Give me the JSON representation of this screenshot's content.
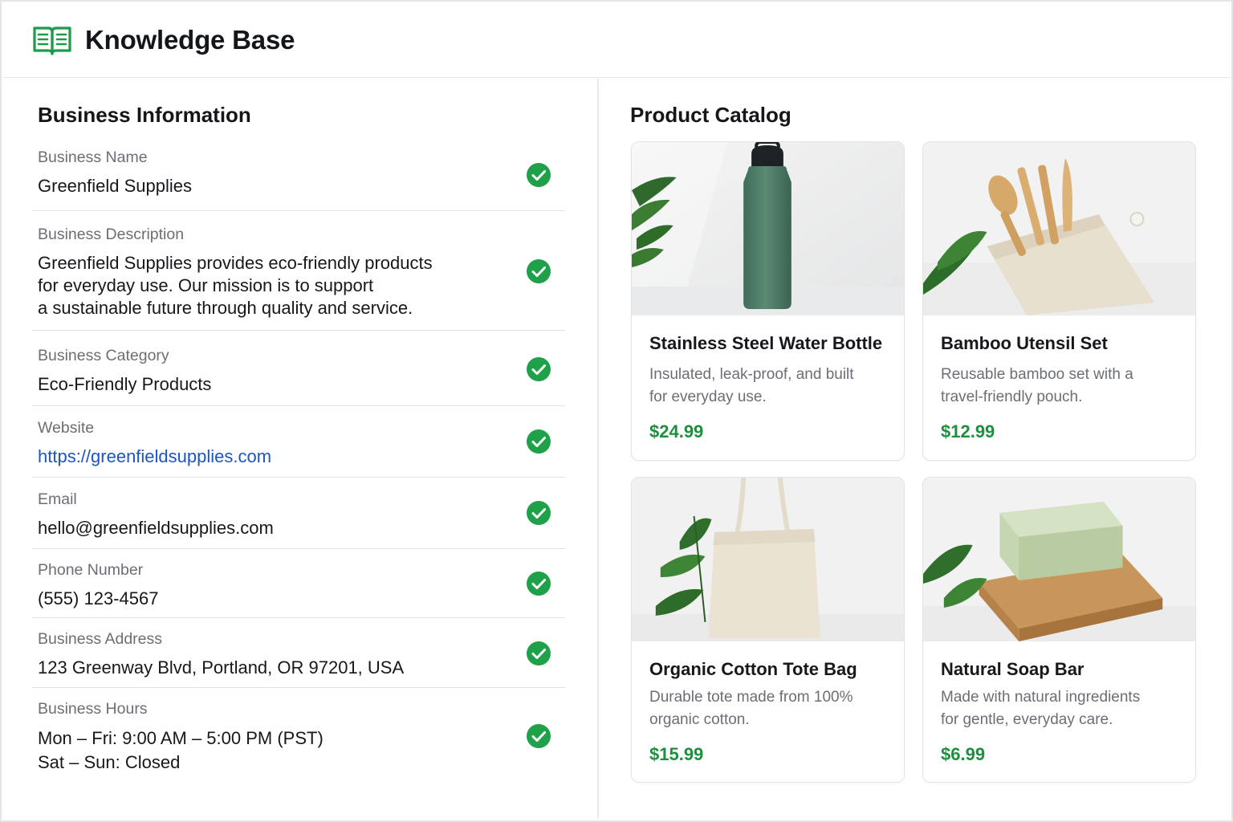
{
  "header": {
    "title": "Knowledge Base",
    "icon": "book-icon",
    "icon_color": "#1e9a4b"
  },
  "business": {
    "title": "Business Information",
    "rows": [
      {
        "label": "Business Name",
        "value": "Greenfield Supplies",
        "verified": true
      },
      {
        "label": "Business Description",
        "value": "Greenfield Supplies provides eco-friendly products\nfor everyday use. Our mission is to support\na sustainable future through quality and service.",
        "verified": true
      },
      {
        "label": "Business Category",
        "value": "Eco-Friendly Products",
        "verified": true
      },
      {
        "label": "Website",
        "value": "https://greenfieldsupplies.com",
        "verified": true
      },
      {
        "label": "Email",
        "value": "hello@greenfieldsupplies.com",
        "verified": true
      },
      {
        "label": "Phone Number",
        "value": "(555) 123-4567",
        "verified": true
      },
      {
        "label": "Business Address",
        "value": "123 Greenway Blvd, Portland, OR 97201, USA",
        "verified": true
      },
      {
        "label": "Business Hours",
        "value": "Mon – Fri: 9:00 AM – 5:00 PM (PST)\nSat – Sun: Closed",
        "verified": true
      }
    ]
  },
  "catalog": {
    "title": "Product Catalog",
    "products": [
      {
        "name": "Stainless Steel Water Bottle",
        "description": "Insulated, leak-proof, and built\nfor everyday use.",
        "price": "$24.99",
        "image": "water-bottle-image"
      },
      {
        "name": "Bamboo Utensil Set",
        "description": "Reusable bamboo set with a\ntravel-friendly pouch.",
        "price": "$12.99",
        "image": "bamboo-utensils-image"
      },
      {
        "name": "Organic Cotton Tote Bag",
        "description": "Durable tote made from 100%\norganic cotton.",
        "price": "$15.99",
        "image": "tote-bag-image"
      },
      {
        "name": "Natural Soap Bar",
        "description": "Made with natural ingredients\nfor gentle, everyday care.",
        "price": "$6.99",
        "image": "soap-bar-image"
      }
    ]
  },
  "colors": {
    "accent_green": "#1e9a4b",
    "price_green": "#1e8f3e",
    "link_blue": "#1a56c4",
    "check_green": "#1fa14a"
  }
}
